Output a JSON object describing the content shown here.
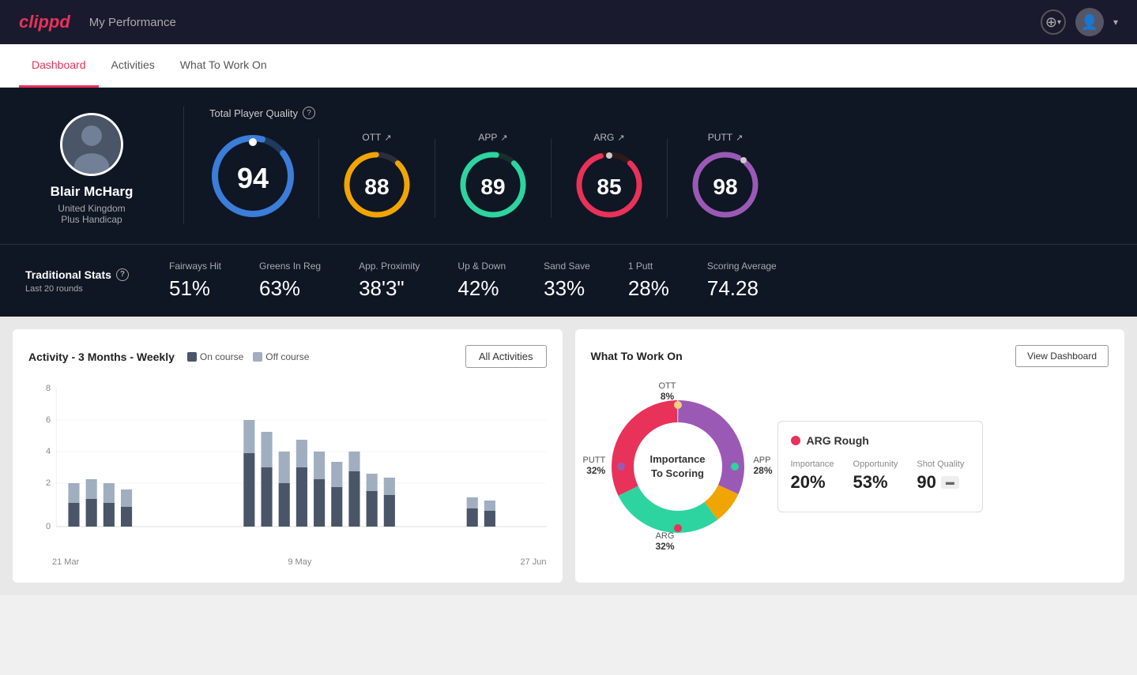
{
  "header": {
    "logo": "clippd",
    "title": "My Performance",
    "add_label": "+",
    "dropdown_label": "▾"
  },
  "nav": {
    "tabs": [
      {
        "id": "dashboard",
        "label": "Dashboard",
        "active": true
      },
      {
        "id": "activities",
        "label": "Activities",
        "active": false
      },
      {
        "id": "what-to-work-on",
        "label": "What To Work On",
        "active": false
      }
    ]
  },
  "player": {
    "name": "Blair McHarg",
    "country": "United Kingdom",
    "handicap": "Plus Handicap"
  },
  "total_quality": {
    "label": "Total Player Quality",
    "score": "94",
    "segments": [
      {
        "label": "OTT",
        "score": "88",
        "color": "#f0a500"
      },
      {
        "label": "APP",
        "score": "89",
        "color": "#2dd4a0"
      },
      {
        "label": "ARG",
        "score": "85",
        "color": "#e8325a"
      },
      {
        "label": "PUTT",
        "score": "98",
        "color": "#9b59b6"
      }
    ]
  },
  "traditional_stats": {
    "label": "Traditional Stats",
    "sublabel": "Last 20 rounds",
    "stats": [
      {
        "name": "Fairways Hit",
        "value": "51%"
      },
      {
        "name": "Greens In Reg",
        "value": "63%"
      },
      {
        "name": "App. Proximity",
        "value": "38'3\""
      },
      {
        "name": "Up & Down",
        "value": "42%"
      },
      {
        "name": "Sand Save",
        "value": "33%"
      },
      {
        "name": "1 Putt",
        "value": "28%"
      },
      {
        "name": "Scoring Average",
        "value": "74.28"
      }
    ]
  },
  "activity_chart": {
    "title": "Activity - 3 Months - Weekly",
    "legend": {
      "on_course": "On course",
      "off_course": "Off course"
    },
    "all_activities_btn": "All Activities",
    "x_labels": [
      "21 Mar",
      "9 May",
      "27 Jun"
    ],
    "colors": {
      "on_course": "#4a5568",
      "off_course": "#a0aec0"
    }
  },
  "what_to_work_on": {
    "title": "What To Work On",
    "view_dashboard_btn": "View Dashboard",
    "donut_center": "Importance\nTo Scoring",
    "segments": [
      {
        "label": "OTT",
        "pct": "8%",
        "color": "#f0a500"
      },
      {
        "label": "APP",
        "pct": "28%",
        "color": "#2dd4a0"
      },
      {
        "label": "ARG",
        "pct": "32%",
        "color": "#e8325a"
      },
      {
        "label": "PUTT",
        "pct": "32%",
        "color": "#9b59b6"
      }
    ],
    "info_card": {
      "title": "ARG Rough",
      "metrics": [
        {
          "label": "Importance",
          "value": "20%"
        },
        {
          "label": "Opportunity",
          "value": "53%"
        },
        {
          "label": "Shot Quality",
          "value": "90"
        }
      ]
    }
  }
}
